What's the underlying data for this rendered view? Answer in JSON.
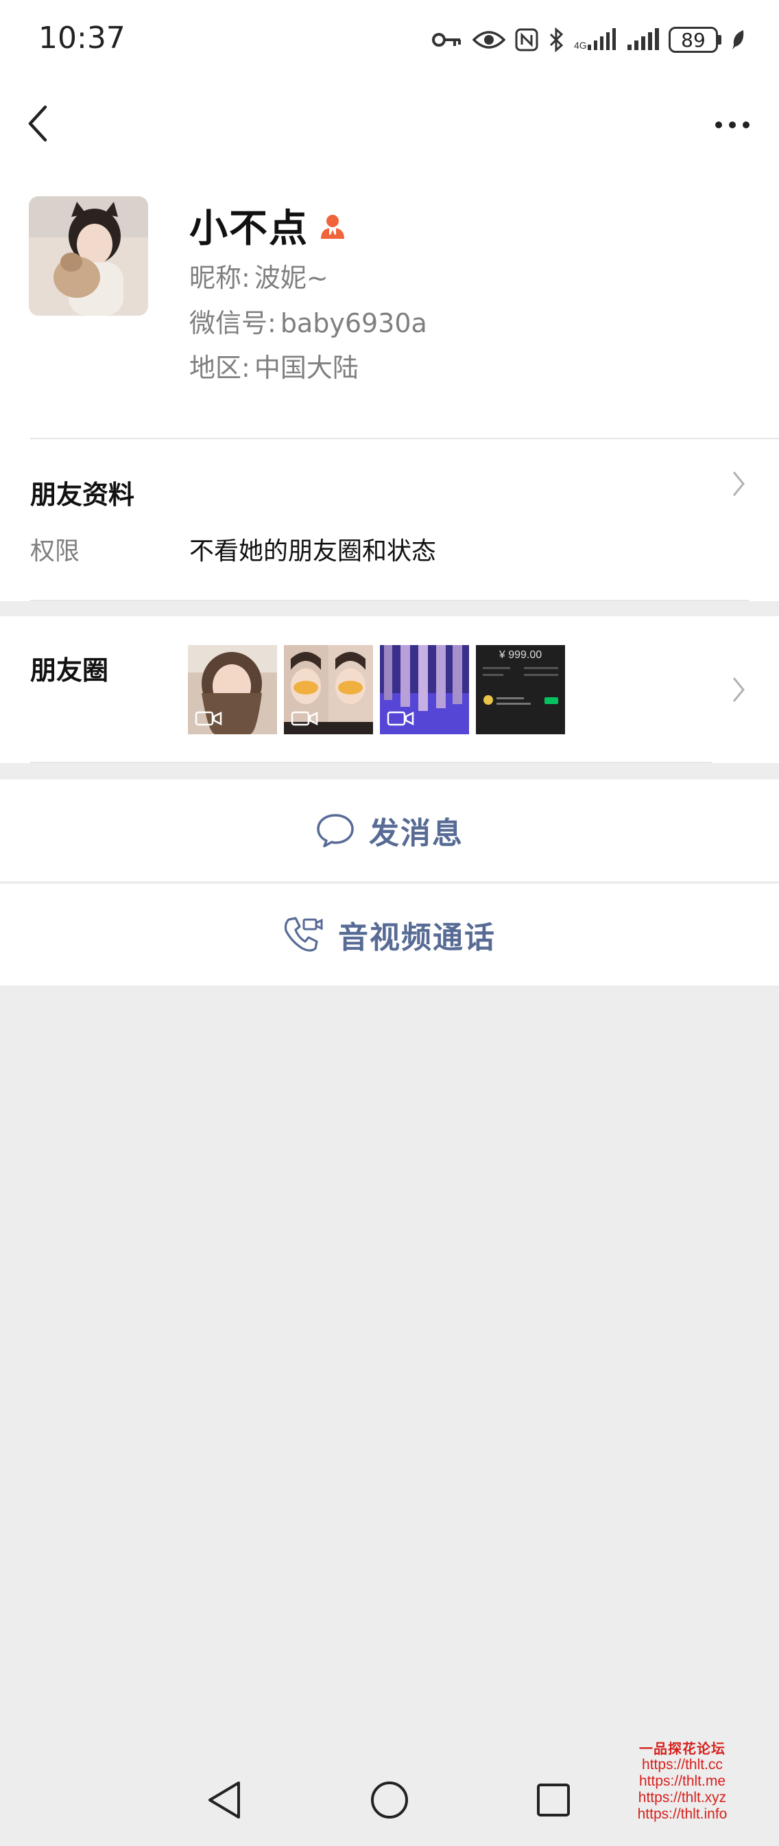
{
  "status_bar": {
    "time": "10:37",
    "battery": "89",
    "icons": [
      "key-icon",
      "eye-icon",
      "nfc-icon",
      "bluetooth-icon",
      "signal-icon",
      "signal-icon",
      "battery-icon",
      "leaf-icon"
    ]
  },
  "header": {
    "back_icon": "chevron-left-icon",
    "more_icon": "more-dots-icon"
  },
  "profile": {
    "remark_name": "小不点",
    "gender_icon": "female-icon",
    "nickname_label": "昵称:",
    "nickname": "波妮~",
    "wechat_id_label": "微信号:",
    "wechat_id": "baby6930a",
    "region_label": "地区:",
    "region": "中国大陆"
  },
  "friend_info": {
    "title": "朋友资料",
    "permission_label": "权限",
    "permission_value": "不看她的朋友圈和状态"
  },
  "moments": {
    "title": "朋友圈",
    "thumbs": [
      {
        "type": "video",
        "desc": "portrait"
      },
      {
        "type": "video",
        "desc": "two-faces"
      },
      {
        "type": "video",
        "desc": "blue-stage"
      },
      {
        "type": "image",
        "desc": "payment-screenshot",
        "amount": "¥ 999.00"
      }
    ]
  },
  "actions": {
    "message_label": "发消息",
    "call_label": "音视频通话"
  },
  "watermark": {
    "title": "一品探花论坛",
    "urls": [
      "https://thlt.cc",
      "https://thlt.me",
      "https://thlt.xyz",
      "https://thlt.info"
    ]
  },
  "colors": {
    "link_blue": "#576b95",
    "gender_red": "#f0643c",
    "watermark_red": "#d6201c"
  }
}
